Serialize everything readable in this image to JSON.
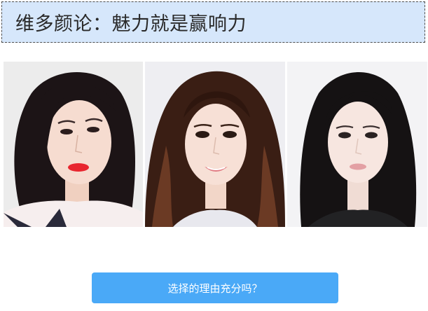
{
  "header": {
    "title": "维多颜论：魅力就是赢响力"
  },
  "photos": [
    {
      "name": "portrait-woman-1"
    },
    {
      "name": "portrait-woman-2"
    },
    {
      "name": "portrait-woman-3"
    }
  ],
  "cta": {
    "label": "选择的理由充分吗？"
  },
  "colors": {
    "banner_bg": "#d6e7fb",
    "button_bg": "#4aa9f7",
    "button_text": "#ffffff"
  }
}
